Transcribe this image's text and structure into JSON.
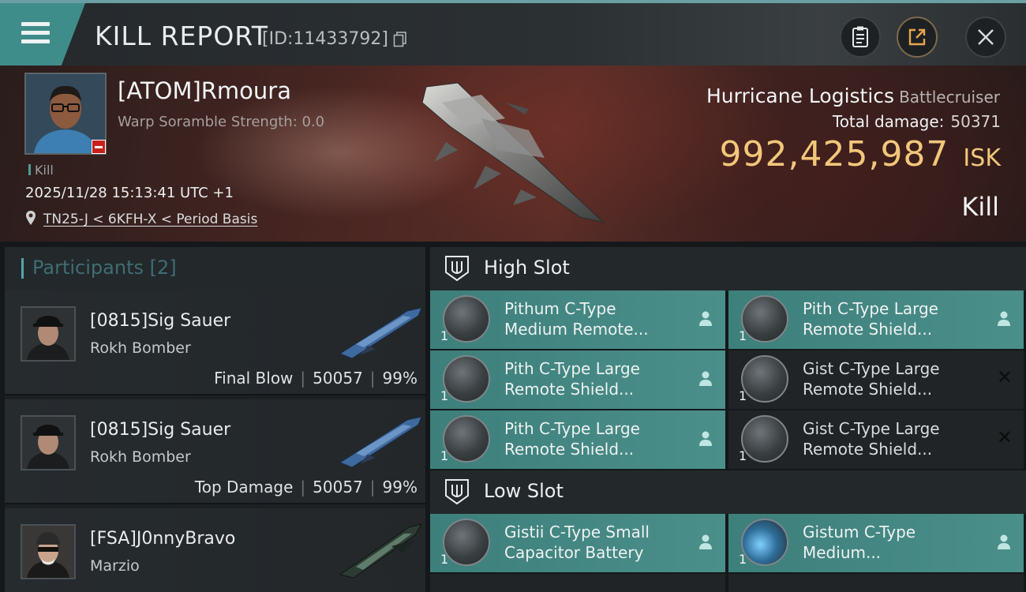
{
  "header": {
    "title": "KILL REPORT",
    "report_id": "[ID:11433792]"
  },
  "victim": {
    "name": "[ATOM]Rmoura",
    "warp_scramble": "Warp Soramble Strength: 0.0",
    "kill_tag": "Kill",
    "datetime": "2025/11/28 15:13:41 UTC +1",
    "location": "TN25-J < 6KFH-X < Period Basis",
    "ship_name": "Hurricane Logistics",
    "ship_class": "Battlecruiser",
    "total_damage_label": "Total damage:",
    "total_damage": "50371",
    "isk_value": "992,425,987",
    "isk_unit": "ISK",
    "result": "Kill"
  },
  "participants": {
    "title": "Participants",
    "count": "[2]",
    "items": [
      {
        "name": "[0815]Sig Sauer",
        "ship": "Rokh Bomber",
        "role": "Final Blow",
        "damage": "50057",
        "percent": "99%"
      },
      {
        "name": "[0815]Sig Sauer",
        "ship": "Rokh Bomber",
        "role": "Top Damage",
        "damage": "50057",
        "percent": "99%"
      },
      {
        "name": "[FSA]J0nnyBravo",
        "ship": "Marzio",
        "role": "",
        "damage": "",
        "percent": ""
      }
    ]
  },
  "slots": {
    "high": {
      "title": "High Slot",
      "modules": [
        {
          "qty": "1",
          "name": "Pithum C-Type Medium Remote...",
          "state": "dropped"
        },
        {
          "qty": "1",
          "name": "Pith C-Type Large Remote Shield...",
          "state": "dropped"
        },
        {
          "qty": "1",
          "name": "Pith C-Type Large Remote Shield...",
          "state": "dropped"
        },
        {
          "qty": "1",
          "name": "Gist C-Type Large Remote Shield...",
          "state": "destroyed"
        },
        {
          "qty": "1",
          "name": "Pith C-Type Large Remote Shield...",
          "state": "dropped"
        },
        {
          "qty": "1",
          "name": "Gist C-Type Large Remote Shield...",
          "state": "destroyed"
        }
      ]
    },
    "low": {
      "title": "Low Slot",
      "modules": [
        {
          "qty": "1",
          "name": "Gistii C-Type Small Capacitor Battery",
          "state": "dropped"
        },
        {
          "qty": "1",
          "name": "Gistum C-Type Medium...",
          "state": "dropped"
        }
      ]
    }
  },
  "icons": {
    "menu": "hamburger-menu-icon",
    "copy": "copy-icon",
    "clipboard": "clipboard-icon",
    "share": "share-icon",
    "close": "close-icon",
    "pin": "location-pin-icon",
    "slot": "slot-fork-icon",
    "person": "person-icon",
    "destroyed": "x-icon"
  },
  "colors": {
    "accent_teal": "#3d7f7b",
    "isk_gold": "#f3c77a",
    "victim_badge_red": "#c7221b"
  }
}
